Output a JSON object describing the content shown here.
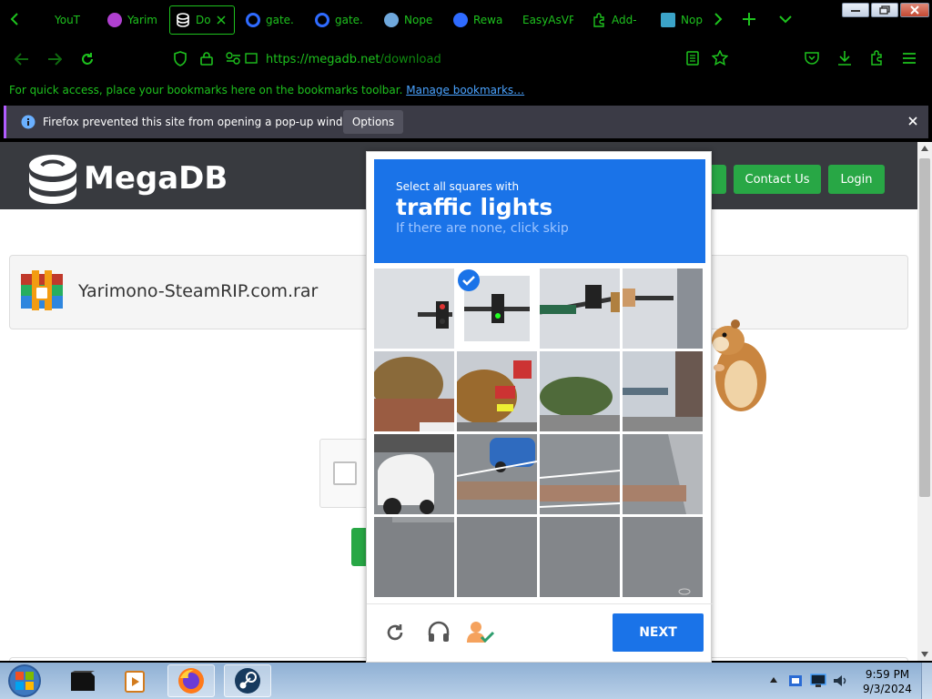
{
  "browser": {
    "tabs": [
      {
        "label": "YouT",
        "icon": "youtube-icon"
      },
      {
        "label": "Yarim",
        "icon": "steamrip-icon"
      },
      {
        "label": "Do",
        "icon": "megadb-icon",
        "active": true
      },
      {
        "label": "gate.",
        "icon": "gate-icon"
      },
      {
        "label": "gate.",
        "icon": "gate-icon"
      },
      {
        "label": "Nope",
        "icon": "robot-icon"
      },
      {
        "label": "Rewa",
        "icon": "reward-icon"
      },
      {
        "label": "EasyAsVPS",
        "icon": "none"
      },
      {
        "label": "Add-",
        "icon": "puzzle-icon"
      },
      {
        "label": "Nop",
        "icon": "bot-icon"
      }
    ],
    "url_host": "https://megadb.net",
    "url_path": "/download",
    "bookmarks_text": "For quick access, place your bookmarks here on the bookmarks toolbar.",
    "bookmarks_link": "Manage bookmarks…",
    "notification": "Firefox prevented this site from opening a pop-up window.",
    "notification_button": "Options",
    "accent_color": "#1ec21e"
  },
  "site": {
    "logo_text": "MegaDB",
    "nav": {
      "contact": "Contact Us",
      "login": "Login"
    },
    "file_name": "Yarimono-SteamRIP.com.rar"
  },
  "captcha": {
    "instruction": "Select all squares with",
    "target": "traffic lights",
    "hint": "If there are none, click skip",
    "next_label": "NEXT",
    "selected_cells": [
      1
    ]
  },
  "taskbar": {
    "time": "9:59 PM",
    "date": "9/3/2024"
  }
}
